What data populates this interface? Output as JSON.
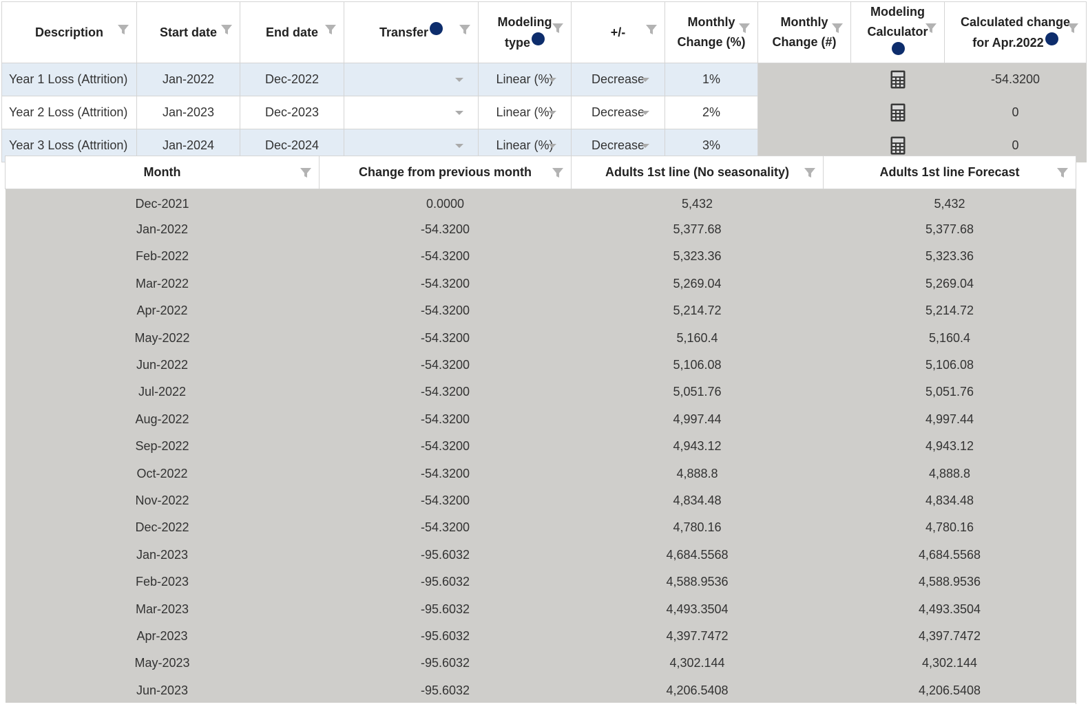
{
  "modeling_table": {
    "headers": {
      "description": "Description",
      "start_date": "Start date",
      "end_date": "End date",
      "transfer": "Transfer",
      "modeling_type_line1": "Modeling",
      "modeling_type_line2": "type",
      "plus_minus": "+/-",
      "monthly_change_pct_line1": "Monthly",
      "monthly_change_pct_line2": "Change (%)",
      "monthly_change_num_line1": "Monthly",
      "monthly_change_num_line2": "Change (#)",
      "modeling_calculator_line1": "Modeling",
      "modeling_calculator_line2": "Calculator",
      "calculated_change_line1": "Calculated change",
      "calculated_change_line2": "for Apr.2022"
    },
    "info_glyph": "i",
    "rows": [
      {
        "description": "Year 1 Loss (Attrition)",
        "start_date": "Jan-2022",
        "end_date": "Dec-2022",
        "transfer": "",
        "modeling_type": "Linear (%)",
        "plus_minus": "Decrease",
        "monthly_change_pct": "1%",
        "monthly_change_num": "",
        "calculated_change": "-54.3200"
      },
      {
        "description": "Year 2 Loss (Attrition)",
        "start_date": "Jan-2023",
        "end_date": "Dec-2023",
        "transfer": "",
        "modeling_type": "Linear (%)",
        "plus_minus": "Decrease",
        "monthly_change_pct": "2%",
        "monthly_change_num": "",
        "calculated_change": "0"
      },
      {
        "description": "Year 3 Loss (Attrition)",
        "start_date": "Jan-2024",
        "end_date": "Dec-2024",
        "transfer": "",
        "modeling_type": "Linear (%)",
        "plus_minus": "Decrease",
        "monthly_change_pct": "3%",
        "monthly_change_num": "",
        "calculated_change": "0"
      }
    ]
  },
  "forecast_table": {
    "headers": {
      "month": "Month",
      "change": "Change from previous month",
      "no_seasonality": "Adults 1st line (No seasonality)",
      "forecast": "Adults 1st line Forecast"
    },
    "rows": [
      {
        "month": "Dec-2021",
        "change": "0.0000",
        "no_seasonality": "5,432",
        "forecast": "5,432"
      },
      {
        "month": "Jan-2022",
        "change": "-54.3200",
        "no_seasonality": "5,377.68",
        "forecast": "5,377.68"
      },
      {
        "month": "Feb-2022",
        "change": "-54.3200",
        "no_seasonality": "5,323.36",
        "forecast": "5,323.36"
      },
      {
        "month": "Mar-2022",
        "change": "-54.3200",
        "no_seasonality": "5,269.04",
        "forecast": "5,269.04"
      },
      {
        "month": "Apr-2022",
        "change": "-54.3200",
        "no_seasonality": "5,214.72",
        "forecast": "5,214.72"
      },
      {
        "month": "May-2022",
        "change": "-54.3200",
        "no_seasonality": "5,160.4",
        "forecast": "5,160.4"
      },
      {
        "month": "Jun-2022",
        "change": "-54.3200",
        "no_seasonality": "5,106.08",
        "forecast": "5,106.08"
      },
      {
        "month": "Jul-2022",
        "change": "-54.3200",
        "no_seasonality": "5,051.76",
        "forecast": "5,051.76"
      },
      {
        "month": "Aug-2022",
        "change": "-54.3200",
        "no_seasonality": "4,997.44",
        "forecast": "4,997.44"
      },
      {
        "month": "Sep-2022",
        "change": "-54.3200",
        "no_seasonality": "4,943.12",
        "forecast": "4,943.12"
      },
      {
        "month": "Oct-2022",
        "change": "-54.3200",
        "no_seasonality": "4,888.8",
        "forecast": "4,888.8"
      },
      {
        "month": "Nov-2022",
        "change": "-54.3200",
        "no_seasonality": "4,834.48",
        "forecast": "4,834.48"
      },
      {
        "month": "Dec-2022",
        "change": "-54.3200",
        "no_seasonality": "4,780.16",
        "forecast": "4,780.16"
      },
      {
        "month": "Jan-2023",
        "change": "-95.6032",
        "no_seasonality": "4,684.5568",
        "forecast": "4,684.5568"
      },
      {
        "month": "Feb-2023",
        "change": "-95.6032",
        "no_seasonality": "4,588.9536",
        "forecast": "4,588.9536"
      },
      {
        "month": "Mar-2023",
        "change": "-95.6032",
        "no_seasonality": "4,493.3504",
        "forecast": "4,493.3504"
      },
      {
        "month": "Apr-2023",
        "change": "-95.6032",
        "no_seasonality": "4,397.7472",
        "forecast": "4,397.7472"
      },
      {
        "month": "May-2023",
        "change": "-95.6032",
        "no_seasonality": "4,302.144",
        "forecast": "4,302.144"
      },
      {
        "month": "Jun-2023",
        "change": "-95.6032",
        "no_seasonality": "4,206.5408",
        "forecast": "4,206.5408"
      }
    ]
  },
  "colors": {
    "header_bg": "#ffffff",
    "editable_row_shaded": "#e3ecf5",
    "readonly_bg": "#cfcecb",
    "info_icon": "#0d2d6c",
    "filter_icon": "#b3b3b3"
  },
  "icons": {
    "filter": "filter-icon",
    "info": "info-icon",
    "calculator": "calculator-icon",
    "dropdown": "chevron-down-icon"
  }
}
